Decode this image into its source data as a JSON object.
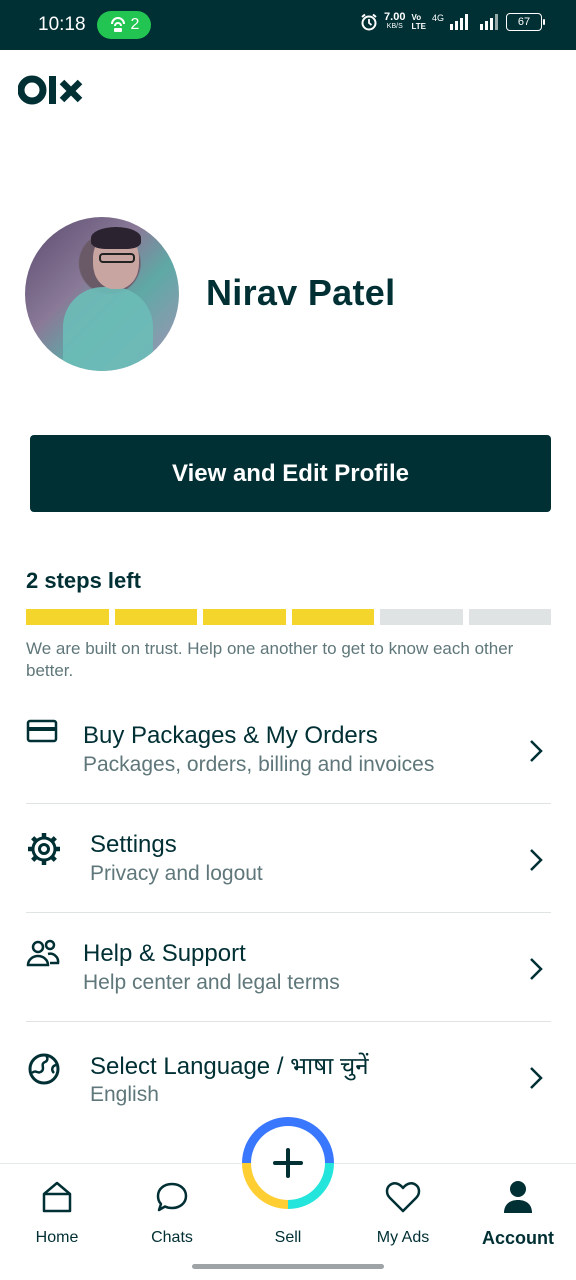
{
  "status_bar": {
    "time": "10:18",
    "hotspot_count": "2",
    "net_speed": "7.00",
    "net_unit": "KB/S",
    "volte_top": "Vo",
    "volte_bottom": "LTE",
    "network": "4G",
    "battery": "67"
  },
  "app": {
    "logo_text": "olx"
  },
  "profile": {
    "name": "Nirav Patel",
    "edit_button": "View and Edit Profile"
  },
  "progress": {
    "title": "2 steps left",
    "total_steps": 6,
    "completed_steps": 4,
    "filled_color": "#f4d52c",
    "empty_color": "#dfe3e4",
    "description": "We are built on trust. Help one another to get to know each other better."
  },
  "menu": {
    "items": [
      {
        "icon": "card-icon",
        "title": "Buy Packages & My Orders",
        "subtitle": "Packages, orders, billing and invoices"
      },
      {
        "icon": "gear-icon",
        "title": "Settings",
        "subtitle": "Privacy and logout"
      },
      {
        "icon": "people-icon",
        "title": "Help & Support",
        "subtitle": "Help center and legal terms"
      },
      {
        "icon": "globe-icon",
        "title": "Select Language / भाषा चुनें",
        "subtitle": "English"
      }
    ]
  },
  "bottom_nav": {
    "home": "Home",
    "chats": "Chats",
    "sell": "Sell",
    "my_ads": "My Ads",
    "account": "Account",
    "active": "account"
  },
  "colors": {
    "primary": "#002f34",
    "accent_green": "#23c552"
  }
}
